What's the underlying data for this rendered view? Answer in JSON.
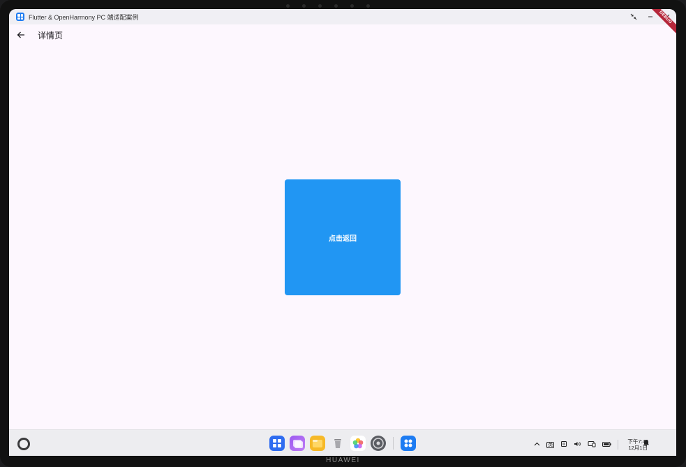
{
  "window": {
    "title": "Flutter & OpenHarmony PC 端适配案例",
    "controls": [
      "compress-icon",
      "minimize-icon",
      "close-icon"
    ]
  },
  "appbar": {
    "back_icon": "arrow-left-icon",
    "title": "详情页",
    "debug_label": "DEBUG"
  },
  "content": {
    "button_label": "点击返回",
    "button_color": "#2196f3"
  },
  "taskbar": {
    "dock_apps": [
      "app-center-icon",
      "multi-window-icon",
      "files-icon",
      "trash-icon",
      "gallery-icon",
      "settings-icon",
      "flutter-app-icon"
    ],
    "clock_time": "下午7:44",
    "clock_date": "12月1日",
    "ime_label": "英"
  },
  "device": {
    "brand": "HUAWEI"
  },
  "colors": {
    "background": "#fdf7fe",
    "accent": "#2196f3",
    "debug_ribbon": "#b5273a"
  }
}
